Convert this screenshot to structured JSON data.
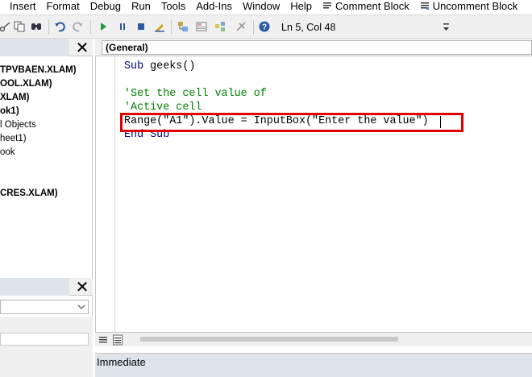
{
  "menubar": {
    "items": [
      "Insert",
      "Format",
      "Debug",
      "Run",
      "Tools",
      "Add-Ins",
      "Window",
      "Help"
    ],
    "comment_block": "Comment Block",
    "uncomment_block": "Uncomment Block"
  },
  "toolbar": {
    "status": "Ln 5, Col 48"
  },
  "project_tree": {
    "items": [
      {
        "text": "TPVBAEN.XLAM)",
        "bold": true
      },
      {
        "text": "OOL.XLAM)",
        "bold": true
      },
      {
        "text": "XLAM)",
        "bold": true
      },
      {
        "text": "ok1)",
        "bold": true
      },
      {
        "text": "l Objects",
        "bold": false
      },
      {
        "text": "heet1)",
        "bold": false
      },
      {
        "text": "ook",
        "bold": false
      },
      {
        "text": "CRES.XLAM)",
        "bold": true
      }
    ]
  },
  "code": {
    "procedure_combo": "(General)",
    "lines": {
      "l1_kw1": "Sub",
      "l1_rest": " geeks()",
      "l2": "'Set the cell value of",
      "l3": "'Active cell",
      "l4": "Range(\"A1\").Value = InputBox(\"Enter the value\")",
      "l5": "End Sub"
    }
  },
  "immediate": {
    "title": "Immediate"
  },
  "colors": {
    "keyword": "#00007f",
    "comment": "#007f00",
    "highlight": "#e00000"
  }
}
